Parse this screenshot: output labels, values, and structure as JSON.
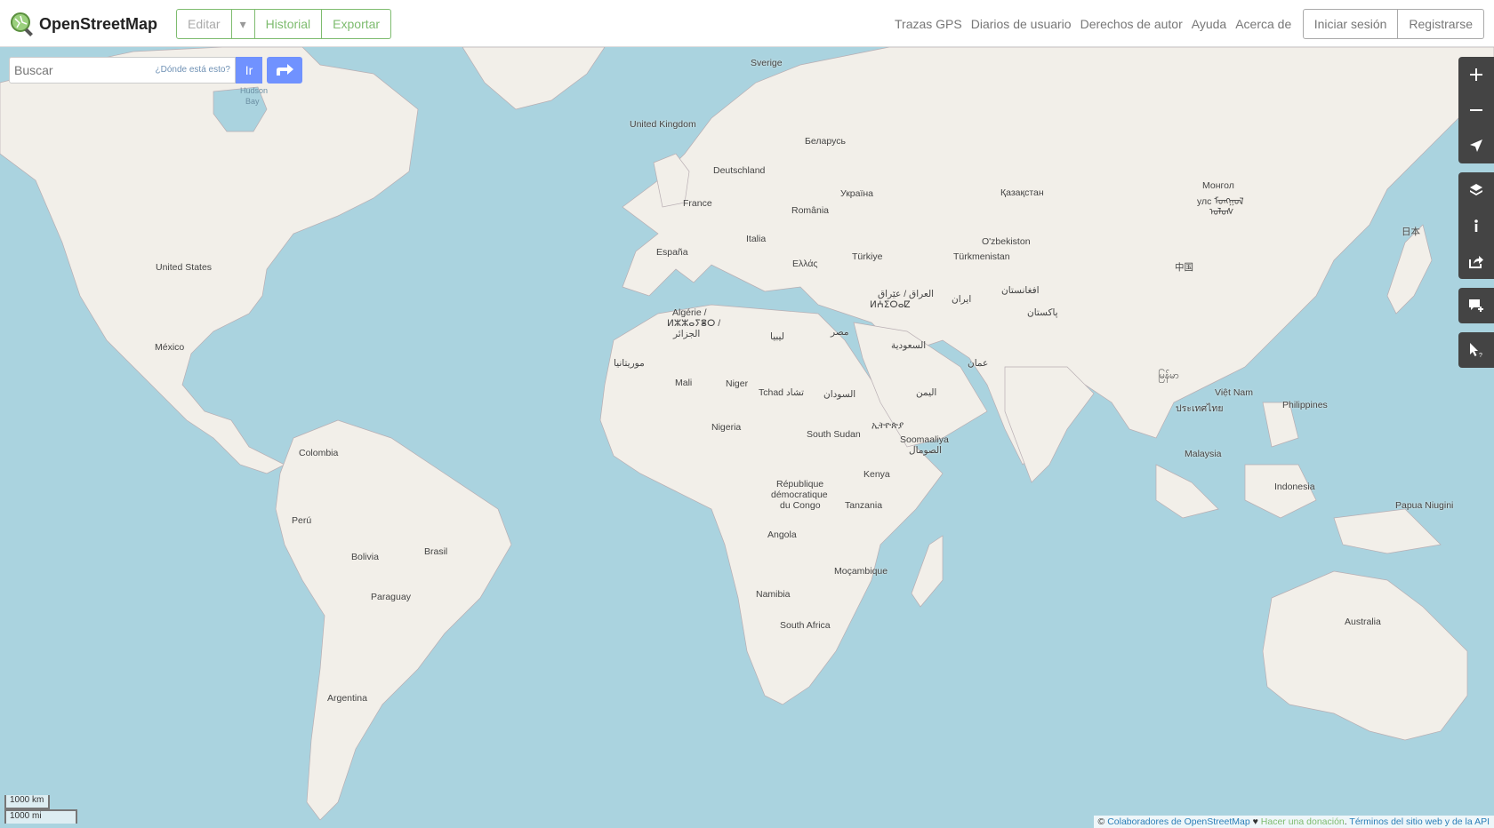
{
  "header": {
    "brand": "OpenStreetMap",
    "edit_label": "Editar",
    "history_label": "Historial",
    "export_label": "Exportar",
    "nav": [
      "Trazas GPS",
      "Diarios de usuario",
      "Derechos de autor",
      "Ayuda",
      "Acerca de"
    ],
    "login_label": "Iniciar sesión",
    "signup_label": "Registrarse"
  },
  "search": {
    "placeholder": "Buscar",
    "where_link": "¿Dónde está esto?",
    "go_label": "Ir"
  },
  "map": {
    "labels": {
      "sverige": "Sverige",
      "uk": "United Kingdom",
      "belarus": "Беларусь",
      "deutschland": "Deutschland",
      "ukraina": "Україна",
      "kazakhstan": "Қазақстан",
      "mongolia1": "Монгол",
      "mongolia2": "улс ᠮᠣᠩᠭᠣᠯ",
      "mongolia3": "ᠤᠯᠤᠰ",
      "japan": "日本",
      "france": "France",
      "romania": "România",
      "italia": "Italia",
      "uzbekistan": "O'zbekiston",
      "espana": "España",
      "turkiye": "Türkiye",
      "turkmenistan": "Türkmenistan",
      "china": "中国",
      "ellas": "Ελλάς",
      "iraq": "العراق / عێراق",
      "iraq2": "ⵍⵄⵉⵔⴰⵇ",
      "iran": "ایران",
      "afghanistan": "افغانستان",
      "pakistan": "پاکستان",
      "algerie1": "Algérie /",
      "algerie2": "ⵍⵣⵣⴰⵢⴻⵔ /",
      "algerie3": "الجزائر",
      "libya": "ليبيا",
      "egypt": "مصر",
      "saudi": "السعودية",
      "oman": "عمان",
      "mauritania": "موريتانيا",
      "mali": "Mali",
      "niger": "Niger",
      "tchad": "Tchad تشاد",
      "sudan": "السودان",
      "yemen": "اليمن",
      "myanmar": "မြန်မာ",
      "vietnam": "Việt Nam",
      "philippines": "Philippines",
      "thailand": "ประเทศไทย",
      "nigeria": "Nigeria",
      "ethiopia": "ኢትዮጵያ",
      "south_sudan": "South Sudan",
      "somalia1": "Soomaaliya",
      "somalia2": "الصومال",
      "malaysia": "Malaysia",
      "kenya": "Kenya",
      "indonesia": "Indonesia",
      "drc1": "République",
      "drc2": "démocratique",
      "drc3": "du Congo",
      "tanzania": "Tanzania",
      "png": "Papua Niugini",
      "angola": "Angola",
      "mocambique": "Moçambique",
      "namibia": "Namibia",
      "south_africa": "South Africa",
      "australia": "Australia",
      "usa": "United States",
      "mexico": "México",
      "colombia": "Colombia",
      "peru": "Perú",
      "brasil": "Brasil",
      "bolivia": "Bolivia",
      "paraguay": "Paraguay",
      "argentina": "Argentina",
      "hudson1": "Hudson",
      "hudson2": "Bay"
    }
  },
  "controls": {
    "zoom_in_icon": "plus-icon",
    "zoom_out_icon": "minus-icon",
    "locate_icon": "location-arrow-icon",
    "layers_icon": "layers-icon",
    "info_icon": "info-icon",
    "share_icon": "share-icon",
    "note_icon": "add-note-icon",
    "query_icon": "query-cursor-icon"
  },
  "scale": {
    "km": "1000 km",
    "mi": "1000 mi"
  },
  "attribution": {
    "prefix": "© ",
    "contributors": "Colaboradores de OpenStreetMap",
    "heart": " ♥ ",
    "donate": "Hacer una donación",
    "sep": ". ",
    "terms": "Términos del sitio web y de la API"
  },
  "colors": {
    "water": "#aad3df",
    "land": "#f2efe9",
    "accent": "#7ebc6f",
    "search_button": "#7092ff",
    "control_bg": "#444444"
  }
}
